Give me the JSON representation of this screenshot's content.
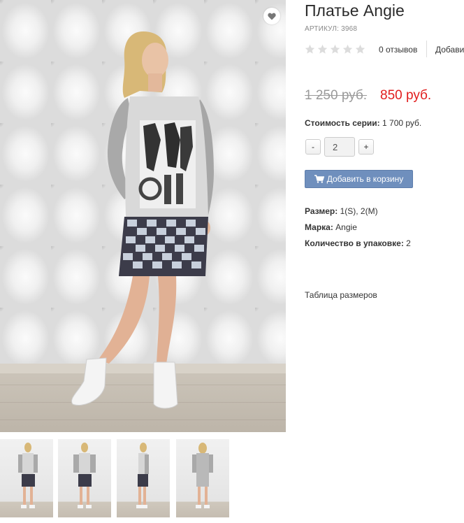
{
  "product": {
    "title": "Платье Angie",
    "sku_label": "АРТИКУЛ: 3968"
  },
  "rating": {
    "stars_filled": 0,
    "stars_total": 5,
    "reviews_label": "0 отзывов",
    "add_review_label": "Добави"
  },
  "price": {
    "old": "1 250 руб.",
    "new": "850 руб."
  },
  "series": {
    "label": "Стоимость серии:",
    "value": "1 700 руб."
  },
  "quantity": {
    "minus": "-",
    "value": "2",
    "plus": "+"
  },
  "cart": {
    "label": "Добавить в корзину",
    "icon": "shopping-cart-icon"
  },
  "props": [
    {
      "label": "Размер:",
      "value": "1(S), 2(M)"
    },
    {
      "label": "Марка:",
      "value": "Angie"
    },
    {
      "label": "Количество в упаковке:",
      "value": "2"
    }
  ],
  "size_table_label": "Таблица размеров",
  "favorite_icon": "heart-icon",
  "colors": {
    "price_new": "#e11d1d",
    "price_old": "#9a9a9a",
    "button": "#6f8fbd"
  },
  "thumbnails_count": 4
}
